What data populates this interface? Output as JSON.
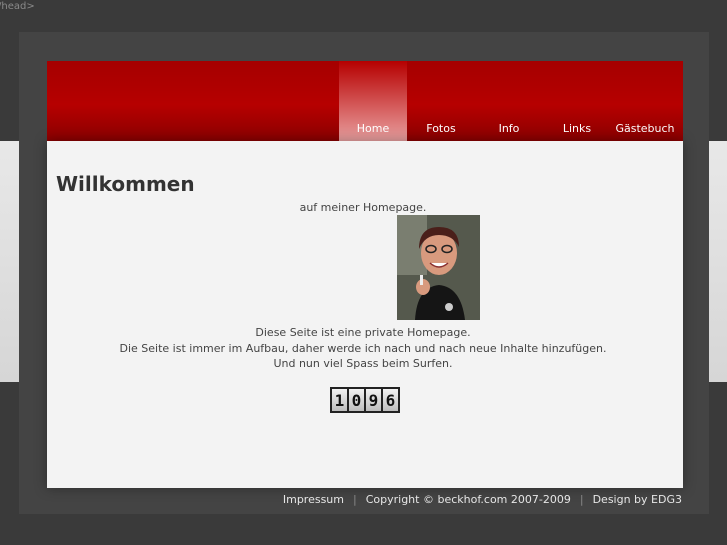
{
  "stray_text": "/head>",
  "nav": {
    "items": [
      {
        "label": "Home",
        "active": true
      },
      {
        "label": "Fotos",
        "active": false
      },
      {
        "label": "Info",
        "active": false
      },
      {
        "label": "Links",
        "active": false
      },
      {
        "label": "Gästebuch",
        "active": false
      }
    ]
  },
  "content": {
    "title": "Willkommen",
    "subtitle": "auf meiner Homepage.",
    "lines": [
      "Diese Seite ist eine private Homepage.",
      "Die Seite ist immer im Aufbau, daher werde ich nach und nach neue Inhalte hinzufügen.",
      "Und nun viel Spass beim Surfen."
    ],
    "counter_digits": [
      "1",
      "0",
      "9",
      "6"
    ]
  },
  "footer": {
    "impressum": "Impressum",
    "copyright": "Copyright © beckhof.com 2007-2009",
    "design": "Design by EDG3",
    "separator": "|"
  },
  "colors": {
    "header_red": "#b60000",
    "page_background": "#3a3a3a",
    "content_background": "#f3f3f3"
  }
}
